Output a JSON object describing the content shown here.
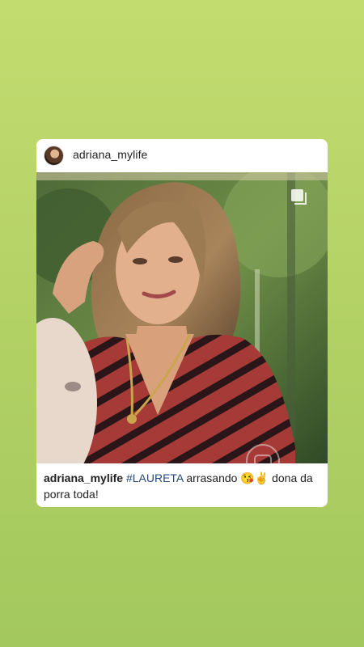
{
  "post": {
    "username": "adriana_mylife",
    "caption": {
      "username": "adriana_mylife",
      "hashtag": "#LAURETA",
      "text_before_emoji": " arrasando ",
      "emojis": "😘✌",
      "text_after_emoji": " dona da porra toda!"
    }
  },
  "icons": {
    "avatar": "profile-avatar",
    "carousel": "multi-image-icon",
    "watermark": "tv-network-logo-watermark"
  },
  "colors": {
    "background_top": "#c3dc70",
    "background_bottom": "#a3c85d",
    "card": "#ffffff",
    "hashtag": "#25487a"
  }
}
